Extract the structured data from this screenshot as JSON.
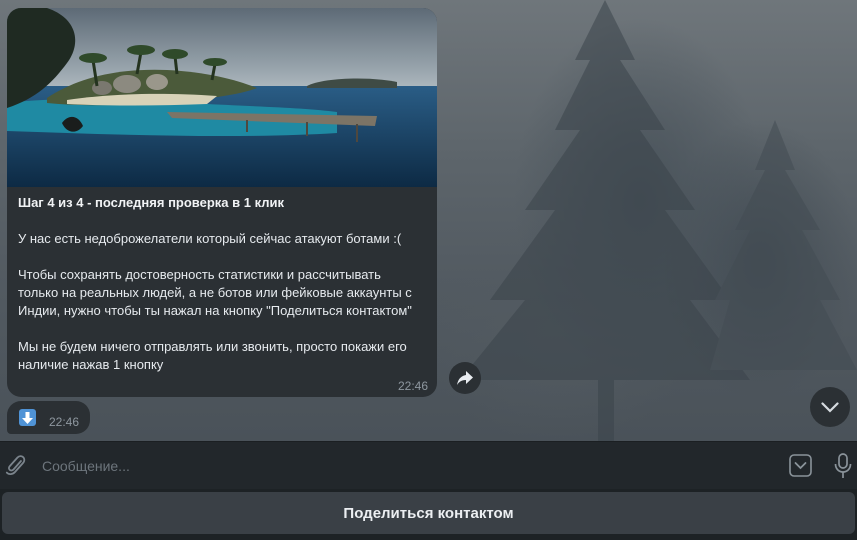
{
  "message": {
    "title": "Шаг 4 из 4 - последняя проверка в 1 клик",
    "text": "У нас есть недоброжелатели который сейчас атакуют ботами :(\n\nЧтобы сохранять достоверность статистики и рассчитывать только на реальных людей, а не ботов или фейковые аккаунты с Индии, нужно чтобы ты нажал на кнопку \"Поделиться контактом\"\n\nМы не будем ничего отправлять или звонить, просто покажи его наличие нажав 1 кнопку",
    "time": "22:46"
  },
  "second_message": {
    "emoji": "down-arrow-emoji",
    "time": "22:46"
  },
  "input": {
    "placeholder": "Сообщение..."
  },
  "keyboard": {
    "button_label": "Поделиться контактом"
  },
  "icons": {
    "forward": "forward-arrow-icon",
    "scroll_down": "chevron-down-icon",
    "attach": "paperclip-icon",
    "keyboard_toggle": "keyboard-toggle-icon",
    "mic": "microphone-icon"
  },
  "colors": {
    "bubble": "#2b3034",
    "input_bar": "#22272b",
    "keyboard_button": "#3a4046",
    "time_text": "#8e979f"
  }
}
